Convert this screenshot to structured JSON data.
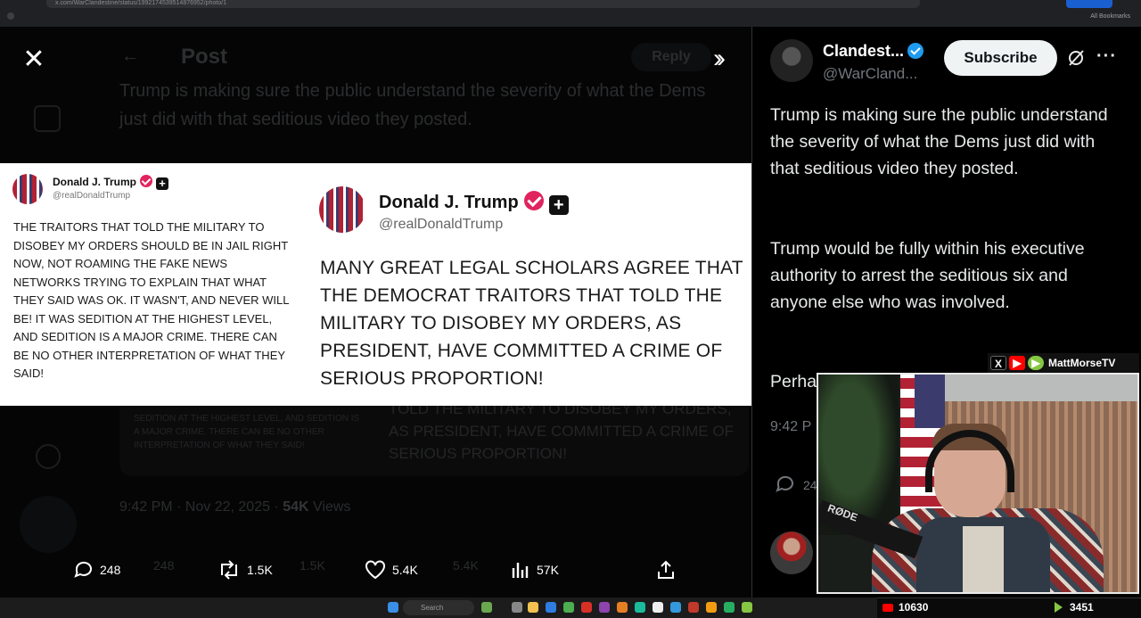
{
  "browser": {
    "url": "x.com/WarClandestine/status/1992174539514876952/photo/1",
    "bookmarks_label": "All Bookmarks"
  },
  "background_post": {
    "header_title": "Post",
    "reply_label": "Reply",
    "text": "Trump is making sure the public understand the severity of what the Dems just did with that seditious video they posted.",
    "card_left_text": "SEDITION AT THE HIGHEST LEVEL, AND SEDITION IS A MAJOR CRIME. THERE CAN BE NO OTHER INTERPRETATION OF WHAT THEY SAID!",
    "card_right_text": "TOLD THE MILITARY TO DISOBEY MY ORDERS, AS PRESIDENT, HAVE COMMITTED A CRIME OF SERIOUS PROPORTION!",
    "date": "9:42 PM · Nov 22, 2025 ·",
    "views_count": "54K",
    "views_label": "Views"
  },
  "image": {
    "left_post": {
      "name": "Donald J. Trump",
      "handle": "@realDonaldTrump",
      "text": "THE TRAITORS THAT TOLD THE MILITARY TO DISOBEY MY ORDERS SHOULD BE IN JAIL RIGHT NOW, NOT ROAMING THE FAKE NEWS NETWORKS TRYING TO EXPLAIN THAT WHAT THEY SAID WAS OK. IT WASN'T, AND NEVER WILL BE! IT WAS SEDITION AT THE HIGHEST LEVEL, AND SEDITION IS A MAJOR CRIME. THERE CAN BE NO OTHER INTERPRETATION OF WHAT THEY SAID!"
    },
    "right_post": {
      "name": "Donald J. Trump",
      "handle": "@realDonaldTrump",
      "text": "MANY GREAT LEGAL SCHOLARS AGREE THAT THE DEMOCRAT TRAITORS THAT TOLD THE MILITARY TO DISOBEY MY ORDERS, AS PRESIDENT, HAVE COMMITTED A CRIME OF SERIOUS PROPORTION!"
    }
  },
  "actions": {
    "replies": "248",
    "reposts": "1.5K",
    "likes": "5.4K",
    "views": "57K"
  },
  "right_panel": {
    "author_name": "Clandest...",
    "author_handle": "@WarCland...",
    "subscribe_label": "Subscribe",
    "paragraph1": "Trump is making sure the public understand the severity of what the Dems just did with that seditious video they posted.",
    "paragraph2": "Trump would be fully within his executive authority to arrest the seditious six and anyone else who was involved.",
    "paragraph3_start": "Perha",
    "time": "9:42 P",
    "reply_count": "24"
  },
  "stream_overlay": {
    "handle": "MattMorseTV",
    "mic_brand": "RØDE",
    "youtube_viewers": "10630",
    "rumble_viewers": "3451"
  },
  "taskbar": {
    "search_label": "Search"
  },
  "colors": {
    "accent_blue": "#1d9bf0",
    "trump_badge": "#e0245e",
    "youtube_red": "#ff0000",
    "rumble_green": "#85c742"
  }
}
